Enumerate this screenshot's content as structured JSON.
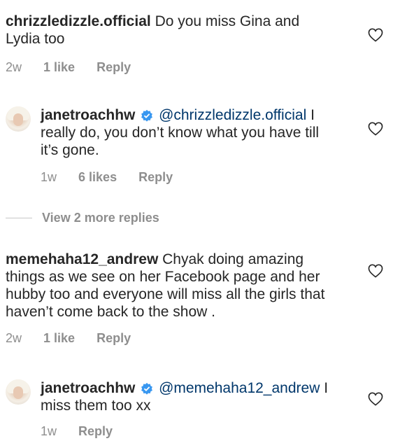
{
  "comments": [
    {
      "username": "chrizzledizzle.official",
      "text": "Do you miss Gina and Lydia too",
      "age": "2w",
      "likes": "1 like",
      "reply": "Reply"
    },
    {
      "username": "janetroachhw",
      "mention": "@chrizzledizzle.official",
      "text": "I really do, you don’t know what you have till it’s gone.",
      "age": "1w",
      "likes": "6 likes",
      "reply": "Reply"
    },
    {
      "username": "memehaha12_andrew",
      "text": "Chyak doing amazing things  as we see on her Facebook page and her hubby too and everyone will miss all the girls that haven’t come back to the show .",
      "age": "2w",
      "likes": "1 like",
      "reply": "Reply"
    },
    {
      "username": "janetroachhw",
      "mention": "@memehaha12_andrew",
      "text": "I miss them too xx",
      "age": "1w",
      "reply": "Reply"
    }
  ],
  "view_replies_label": "View 2 more replies",
  "icons": {
    "like": "heart-outline-icon",
    "verified": "verified-badge-icon"
  },
  "colors": {
    "text": "#262626",
    "muted": "#8e8e8e",
    "mention": "#00376b",
    "verified": "#3897f0"
  }
}
